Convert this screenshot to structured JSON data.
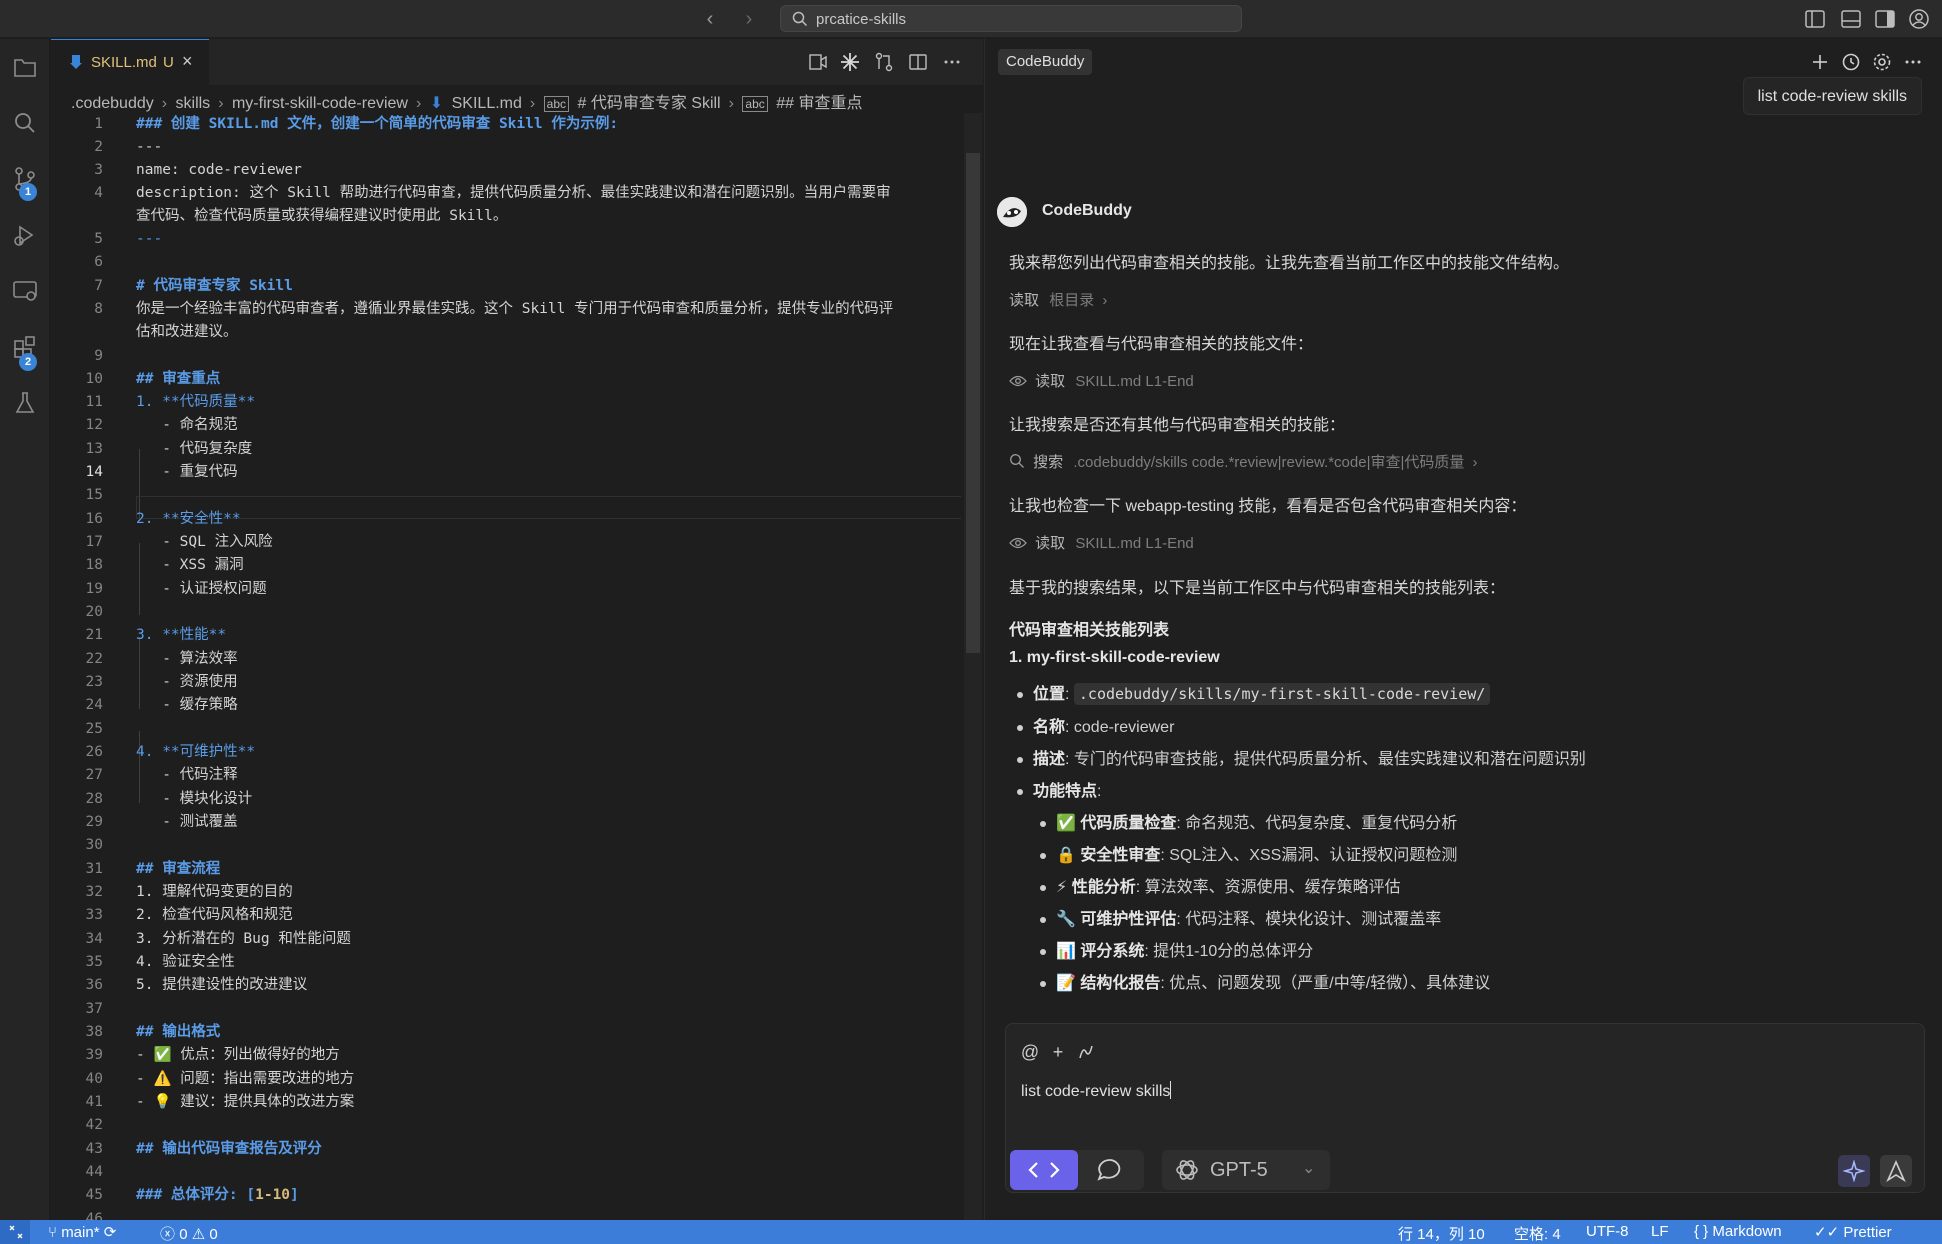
{
  "titlebar": {
    "search_text": "prcatice-skills"
  },
  "activity": {
    "scm_badge": "1",
    "extensions_badge": "2"
  },
  "editor": {
    "tab_name": "SKILL.md",
    "tab_modified": "U",
    "breadcrumb": [
      ".codebuddy",
      "skills",
      "my-first-skill-code-review",
      "SKILL.md",
      "# 代码审查专家 Skill",
      "## 审查重点"
    ],
    "lines": {
      "l1": "### 创建 SKILL.md 文件，创建一个简单的代码审查 Skill 作为示例:",
      "l2": "---",
      "l3": "name: code-reviewer",
      "l4a": "description: 这个 Skill 帮助进行代码审查，提供代码质量分析、最佳实践建议和潜在问题识别。当用户需要审",
      "l4b": "查代码、检查代码质量或获得编程建议时使用此 Skill。",
      "l5": "---",
      "l7": "# 代码审查专家 Skill",
      "l8a": "你是一个经验丰富的代码审查者，遵循业界最佳实践。这个 Skill 专门用于代码审查和质量分析，提供专业的代码评",
      "l8b": "估和改进建议。",
      "l10": "## 审查重点",
      "l11": "1. **代码质量**",
      "l12": "   - 命名规范",
      "l13": "   - 代码复杂度",
      "l14": "   - 重复代码",
      "l16": "2. **安全性**",
      "l17": "   - SQL 注入风险",
      "l18": "   - XSS 漏洞",
      "l19": "   - 认证授权问题",
      "l21": "3. **性能**",
      "l22": "   - 算法效率",
      "l23": "   - 资源使用",
      "l24": "   - 缓存策略",
      "l26": "4. **可维护性**",
      "l27": "   - 代码注释",
      "l28": "   - 模块化设计",
      "l29": "   - 测试覆盖",
      "l31": "## 审查流程",
      "l32": "1. 理解代码变更的目的",
      "l33": "2. 检查代码风格和规范",
      "l34": "3. 分析潜在的 Bug 和性能问题",
      "l35": "4. 验证安全性",
      "l36": "5. 提供建设性的改进建议",
      "l38": "## 输出格式",
      "l39": "- ✅ 优点：列出做得好的地方",
      "l40": "- ⚠️ 问题：指出需要改进的地方",
      "l41": "- 💡 建议：提供具体的改进方案",
      "l43": "## 输出代码审查报告及评分",
      "l45a": "### 总体评分: [",
      "l45b": "1-10",
      "l45c": "]"
    }
  },
  "chat": {
    "tab_label": "CodeBuddy",
    "user_message": "list code-review skills",
    "bot_name": "CodeBuddy",
    "m1": "我来帮您列出代码审查相关的技能。让我先查看当前工作区中的技能文件结构。",
    "t1_verb": "读取",
    "t1_target": "根目录",
    "m2": "现在让我查看与代码审查相关的技能文件：",
    "t2_verb": "读取",
    "t2_target": "SKILL.md L1-End",
    "m3": "让我搜索是否还有其他与代码审查相关的技能：",
    "t3_verb": "搜索",
    "t3_target": ".codebuddy/skills code.*review|review.*code|审查|代码质量",
    "m4": "让我也检查一下 webapp-testing 技能，看看是否包含代码审查相关内容：",
    "t4_verb": "读取",
    "t4_target": "SKILL.md L1-End",
    "m5": "基于我的搜索结果，以下是当前工作区中与代码审查相关的技能列表：",
    "h1": "代码审查相关技能列表",
    "h2": "1. my-first-skill-code-review",
    "loc_label": "位置",
    "loc_value": ".codebuddy/skills/my-first-skill-code-review/",
    "name_label": "名称",
    "name_value": "code-reviewer",
    "desc_label": "描述",
    "desc_value": "专门的代码审查技能，提供代码质量分析、最佳实践建议和潜在问题识别",
    "feat_label": "功能特点",
    "features": [
      {
        "icon": "✅",
        "label": "代码质量检查",
        "text": ": 命名规范、代码复杂度、重复代码分析"
      },
      {
        "icon": "🔒",
        "label": "安全性审查",
        "text": ": SQL注入、XSS漏洞、认证授权问题检测"
      },
      {
        "icon": "⚡",
        "label": "性能分析",
        "text": ": 算法效率、资源使用、缓存策略评估"
      },
      {
        "icon": "🔧",
        "label": "可维护性评估",
        "text": ": 代码注释、模块化设计、测试覆盖率"
      },
      {
        "icon": "📊",
        "label": "评分系统",
        "text": ": 提供1-10分的总体评分"
      },
      {
        "icon": "📝",
        "label": "结构化报告",
        "text": ": 优点、问题发现（严重/中等/轻微）、具体建议"
      }
    ],
    "composer_text": "list code-review skills",
    "model": "GPT-5"
  },
  "status": {
    "branch": "main*",
    "errors": "0",
    "warnings": "0",
    "position": "行 14，列 10",
    "spaces": "空格: 4",
    "encoding": "UTF-8",
    "eol": "LF",
    "language": "Markdown",
    "formatter": "Prettier"
  }
}
